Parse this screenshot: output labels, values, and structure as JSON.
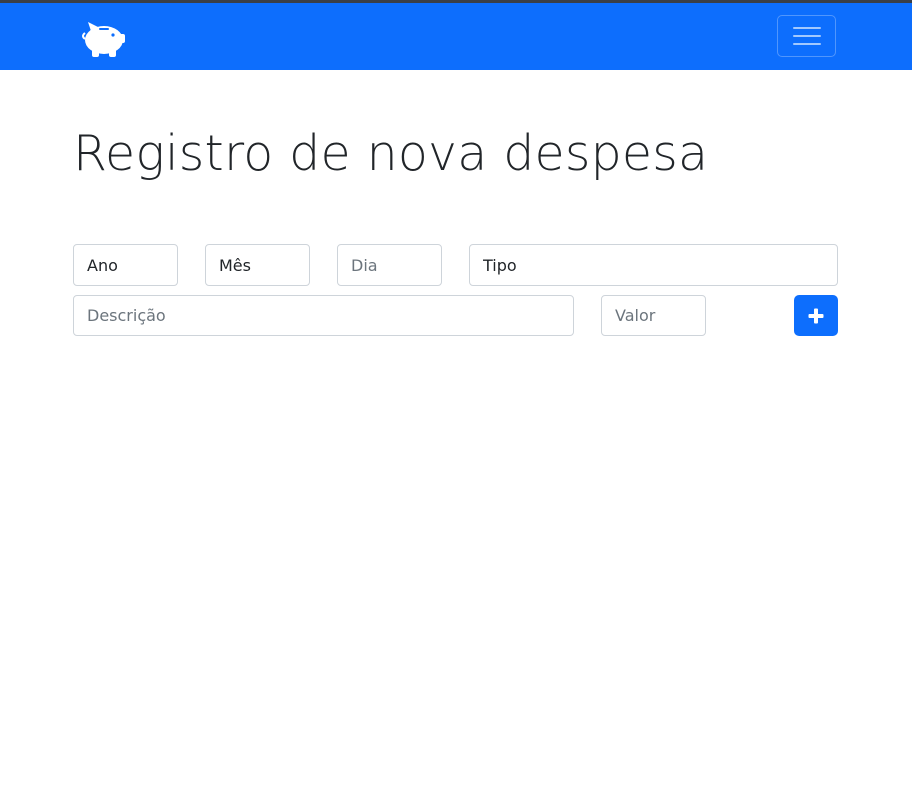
{
  "navbar": {
    "brand_icon": "piggy-bank-icon",
    "toggler_icon": "hamburger-menu-icon",
    "brand_color": "#0d6efd"
  },
  "page": {
    "title": "Registro de nova despesa"
  },
  "form": {
    "ano": {
      "value": "Ano"
    },
    "mes": {
      "value": "Mês"
    },
    "dia": {
      "placeholder": "Dia"
    },
    "tipo": {
      "value": "Tipo"
    },
    "descricao": {
      "placeholder": "Descrição"
    },
    "valor": {
      "placeholder": "Valor"
    },
    "add_button_icon": "plus-icon"
  }
}
